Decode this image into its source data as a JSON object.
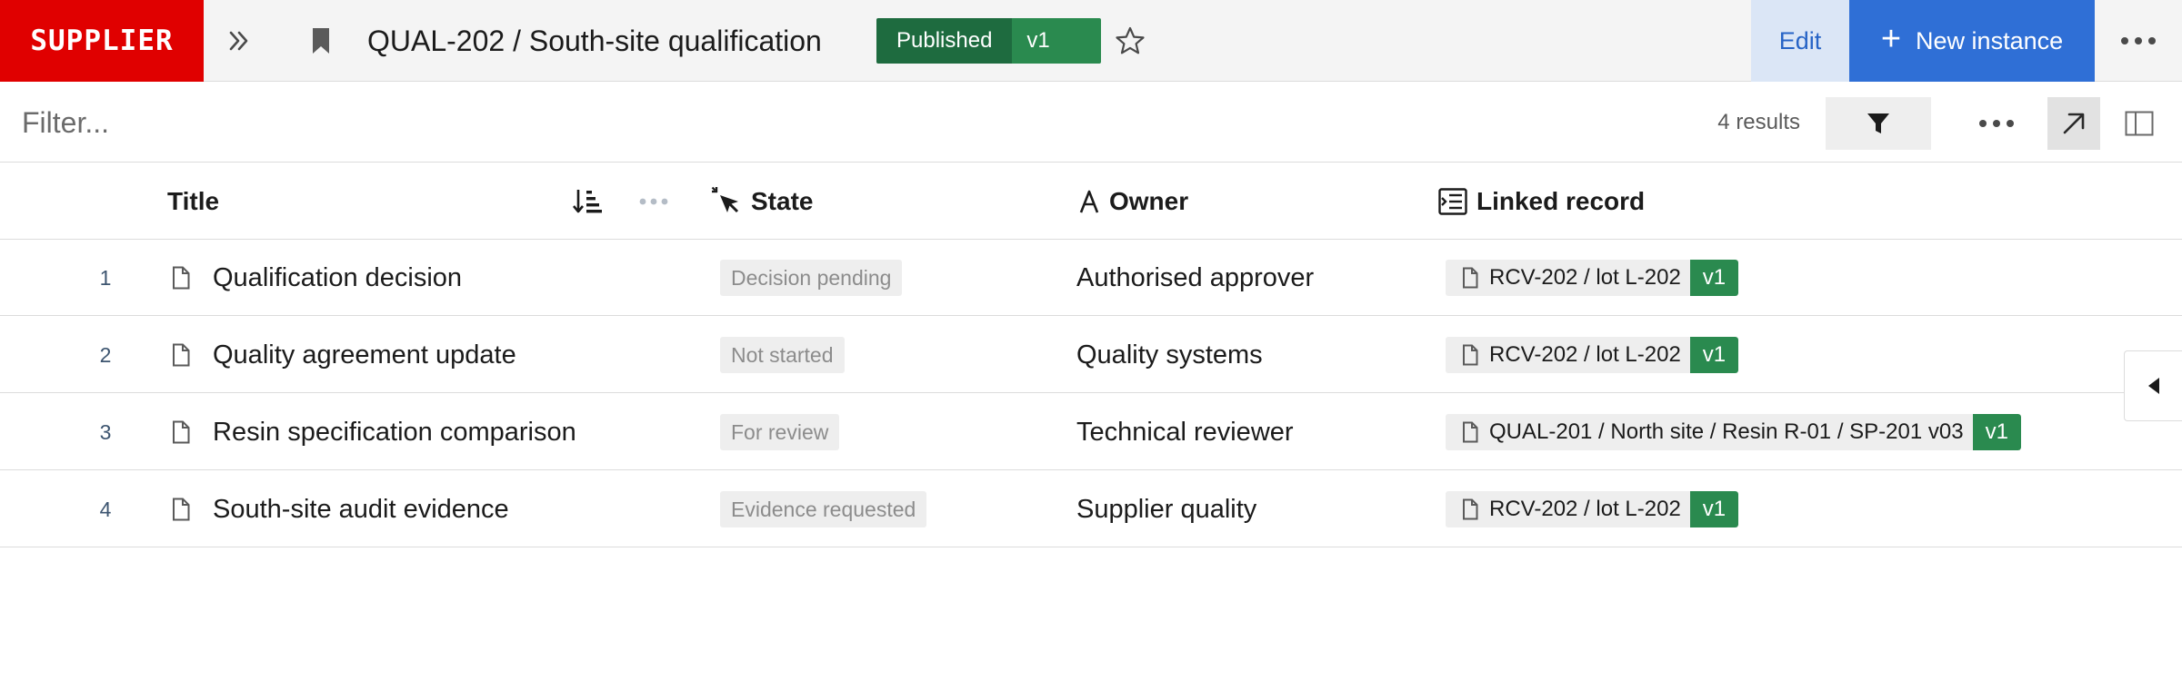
{
  "header": {
    "logo": "SUPPLIER",
    "title": "QUAL-202 / South-site qualification",
    "status": "Published",
    "version": "v1",
    "edit_label": "Edit",
    "new_instance_label": "New instance"
  },
  "filter": {
    "placeholder": "Filter...",
    "results": "4 results"
  },
  "table": {
    "columns": {
      "title": "Title",
      "state": "State",
      "owner": "Owner",
      "linked": "Linked record"
    },
    "rows": [
      {
        "num": "1",
        "title": "Qualification decision",
        "state": "Decision pending",
        "owner": "Authorised approver",
        "linked": "RCV-202 / lot L-202",
        "linked_version": "v1"
      },
      {
        "num": "2",
        "title": "Quality agreement update",
        "state": "Not started",
        "owner": "Quality systems",
        "linked": "RCV-202 / lot L-202",
        "linked_version": "v1"
      },
      {
        "num": "3",
        "title": "Resin specification comparison",
        "state": "For review",
        "owner": "Technical reviewer",
        "linked": "QUAL-201 / North site / Resin R-01 / SP-201 v03",
        "linked_version": "v1"
      },
      {
        "num": "4",
        "title": "South-site audit evidence",
        "state": "Evidence requested",
        "owner": "Supplier quality",
        "linked": "RCV-202 / lot L-202",
        "linked_version": "v1"
      }
    ]
  },
  "colors": {
    "brand": "#e00000",
    "primary": "#2f6fd6",
    "published": "#1e6b3f",
    "version": "#2a8a4f"
  },
  "icons": [
    "double-chevron-right-icon",
    "bookmark-icon",
    "star-icon",
    "plus-icon",
    "more-icon",
    "funnel-icon",
    "arrow-up-right-icon",
    "panel-icon",
    "sort-icon",
    "state-cursor-icon",
    "owner-letter-icon",
    "linked-record-icon",
    "document-icon",
    "caret-left-icon"
  ]
}
